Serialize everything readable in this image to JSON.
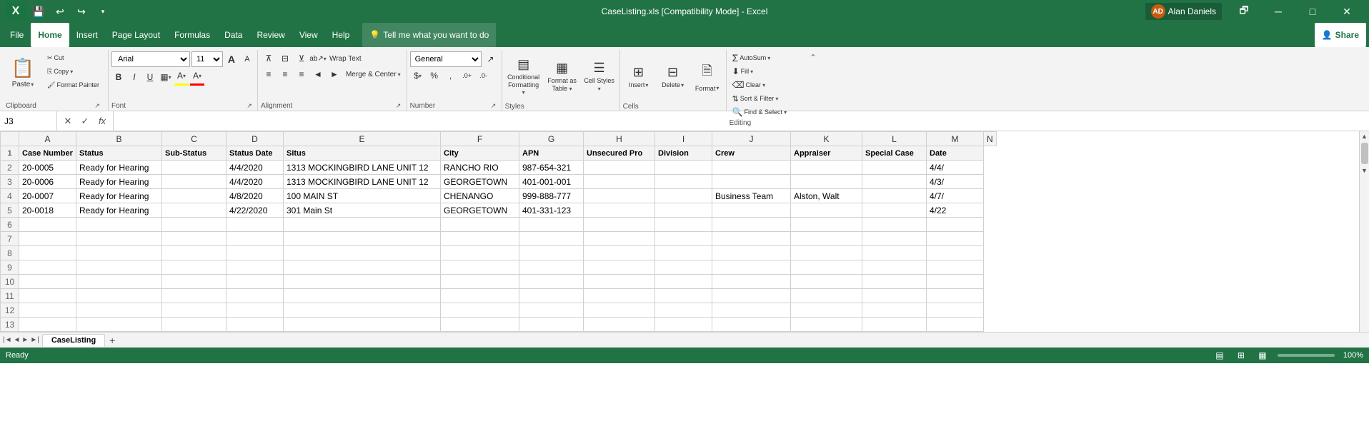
{
  "titleBar": {
    "title": "CaseListing.xls [Compatibility Mode] - Excel",
    "userName": "Alan Daniels",
    "userInitials": "AD",
    "qat": [
      "save",
      "undo",
      "redo",
      "customize"
    ],
    "windowControls": [
      "restore-down",
      "minimize",
      "maximize",
      "close"
    ]
  },
  "menuBar": {
    "items": [
      "File",
      "Home",
      "Insert",
      "Page Layout",
      "Formulas",
      "Data",
      "Review",
      "View",
      "Help"
    ],
    "activeItem": "Home",
    "tellMe": "Tell me what you want to do",
    "share": "Share"
  },
  "ribbon": {
    "clipboard": {
      "label": "Clipboard",
      "paste": "Paste",
      "cut": "Cut",
      "copy": "Copy",
      "formatPainter": "Format Painter"
    },
    "font": {
      "label": "Font",
      "fontName": "Arial",
      "fontSize": "11",
      "bold": "B",
      "italic": "I",
      "underline": "U",
      "borders": "Borders",
      "fillColor": "Fill Color",
      "fontColor": "Font Color",
      "increaseFont": "A",
      "decreaseFont": "A"
    },
    "alignment": {
      "label": "Alignment",
      "wrapText": "Wrap Text",
      "mergeCenter": "Merge & Center",
      "alignTop": "↑",
      "alignMiddle": "↔",
      "alignBottom": "↓",
      "alignLeft": "←",
      "alignCenter": "≡",
      "alignRight": "→",
      "decreaseIndent": "◄",
      "increaseIndent": "►",
      "orientation": "ab"
    },
    "number": {
      "label": "Number",
      "format": "General",
      "currency": "$",
      "percent": "%",
      "comma": ",",
      "increaseDecimal": "+.0",
      "decreaseDecimal": "-.0"
    },
    "styles": {
      "label": "Styles",
      "conditionalFormatting": "Conditional Formatting",
      "formatAsTable": "Format as Table",
      "cellStyles": "Cell Styles"
    },
    "cells": {
      "label": "Cells",
      "insert": "Insert",
      "delete": "Delete",
      "format": "Format"
    },
    "editing": {
      "label": "Editing",
      "autoSum": "AutoSum",
      "fill": "Fill",
      "clear": "Clear",
      "sortFilter": "Sort & Filter",
      "findSelect": "Find & Select"
    }
  },
  "formulaBar": {
    "cellRef": "J3",
    "cancelBtn": "✕",
    "confirmBtn": "✓",
    "functionBtn": "fx",
    "formula": ""
  },
  "spreadsheet": {
    "columns": [
      "",
      "A",
      "B",
      "C",
      "D",
      "E",
      "F",
      "G",
      "H",
      "I",
      "J",
      "K",
      "L",
      "M",
      "N"
    ],
    "rows": [
      {
        "num": "1",
        "cells": [
          "",
          "Case Number",
          "Status",
          "Sub-Status",
          "Status Date",
          "Situs",
          "City",
          "APN",
          "Unsecured Pro",
          "Division",
          "Crew",
          "Appraiser",
          "Special Case",
          "Date"
        ]
      },
      {
        "num": "2",
        "cells": [
          "",
          "20-0005",
          "Ready for Hearing",
          "",
          "4/4/2020",
          "1313 MOCKINGBIRD LANE UNIT 12",
          "RANCHO RIO",
          "987-654-321",
          "",
          "",
          "",
          "",
          "",
          "4/4/"
        ]
      },
      {
        "num": "3",
        "cells": [
          "",
          "20-0006",
          "Ready for Hearing",
          "",
          "4/4/2020",
          "1313 MOCKINGBIRD LANE UNIT 12",
          "GEORGETOWN",
          "401-001-001",
          "",
          "",
          "",
          "",
          "",
          "4/3/"
        ]
      },
      {
        "num": "4",
        "cells": [
          "",
          "20-0007",
          "Ready for Hearing",
          "",
          "4/8/2020",
          "100 MAIN ST",
          "CHENANGO",
          "999-888-777",
          "",
          "",
          "Business Team",
          "Alston, Walt",
          "",
          "4/7/"
        ]
      },
      {
        "num": "5",
        "cells": [
          "",
          "20-0018",
          "Ready for Hearing",
          "",
          "4/22/2020",
          "301 Main St",
          "GEORGETOWN",
          "401-331-123",
          "",
          "",
          "",
          "",
          "",
          "4/22"
        ]
      },
      {
        "num": "6",
        "cells": [
          "",
          "",
          "",
          "",
          "",
          "",
          "",
          "",
          "",
          "",
          "",
          "",
          "",
          ""
        ]
      },
      {
        "num": "7",
        "cells": [
          "",
          "",
          "",
          "",
          "",
          "",
          "",
          "",
          "",
          "",
          "",
          "",
          "",
          ""
        ]
      },
      {
        "num": "8",
        "cells": [
          "",
          "",
          "",
          "",
          "",
          "",
          "",
          "",
          "",
          "",
          "",
          "",
          "",
          ""
        ]
      },
      {
        "num": "9",
        "cells": [
          "",
          "",
          "",
          "",
          "",
          "",
          "",
          "",
          "",
          "",
          "",
          "",
          "",
          ""
        ]
      },
      {
        "num": "10",
        "cells": [
          "",
          "",
          "",
          "",
          "",
          "",
          "",
          "",
          "",
          "",
          "",
          "",
          "",
          ""
        ]
      },
      {
        "num": "11",
        "cells": [
          "",
          "",
          "",
          "",
          "",
          "",
          "",
          "",
          "",
          "",
          "",
          "",
          "",
          ""
        ]
      },
      {
        "num": "12",
        "cells": [
          "",
          "",
          "",
          "",
          "",
          "",
          "",
          "",
          "",
          "",
          "",
          "",
          "",
          ""
        ]
      },
      {
        "num": "13",
        "cells": [
          "",
          "",
          "",
          "",
          "",
          "",
          "",
          "",
          "",
          "",
          "",
          "",
          "",
          ""
        ]
      }
    ]
  },
  "sheetTabs": {
    "tabs": [
      "CaseListing"
    ],
    "activeTab": "CaseListing"
  },
  "statusBar": {
    "mode": "Ready",
    "zoom": "100%"
  }
}
